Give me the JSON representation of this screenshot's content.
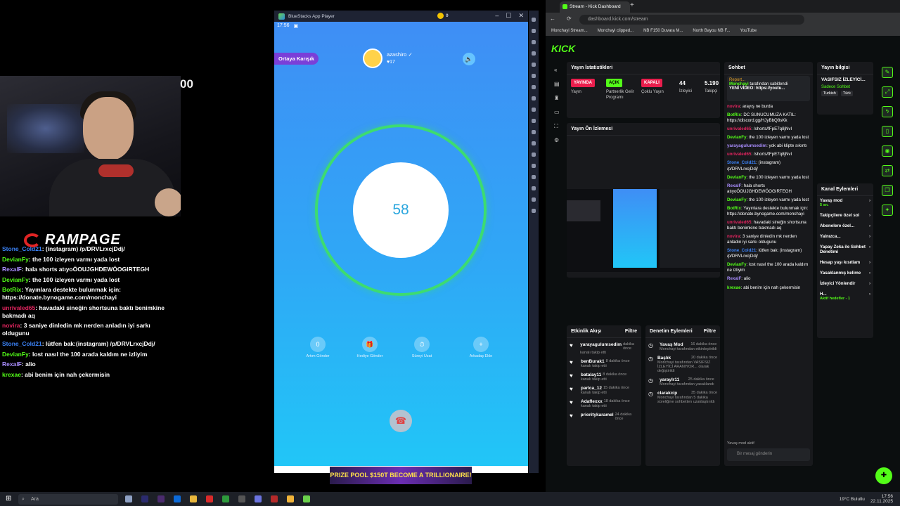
{
  "overlay": {
    "partial_number": "00",
    "brand": "RAMPAGE",
    "chat": [
      {
        "user": "Stone_Cold21",
        "color": "#3b82f6",
        "text": "(instagram) /p/DRVLrxcjDdj/"
      },
      {
        "user": "DevianFy",
        "color": "#53fc18",
        "text": "the 100 izleyen varmı yada lost"
      },
      {
        "user": "RexalF",
        "color": "#a78bfa",
        "text": "hala shorts atıyoÖOUJGHDEWÖOGIRTEGH"
      },
      {
        "user": "DevianFy",
        "color": "#53fc18",
        "text": "the 100 izleyen varmı yada lost"
      },
      {
        "user": "BotRix",
        "color": "#53fc18",
        "text": "Yayınlara destekte bulunmak için: https://donate.bynogame.com/monchayi"
      },
      {
        "user": "unrivaled65",
        "color": "#e0245e",
        "text": "havadaki sineğin shortsuna baktı benimkine bakmadı aq"
      },
      {
        "user": "novira",
        "color": "#e0245e",
        "text": "3 saniye dinledin mk nerden anladın iyi sarkı oldugunu"
      },
      {
        "user": "Stone_Cold21",
        "color": "#3b82f6",
        "text": "lütfen bak:(instagram) /p/DRVLrxcjDdj/"
      },
      {
        "user": "DevianFy",
        "color": "#53fc18",
        "text": "lost nasıl the 100 arada kaldım ne izliyim"
      },
      {
        "user": "RexalF",
        "color": "#a78bfa",
        "text": "alio"
      },
      {
        "user": "krexae",
        "color": "#53fc18",
        "text": "abi benim için nah çekermisin"
      }
    ]
  },
  "bluestacks": {
    "title": "BlueStacks App Player",
    "coins": "0",
    "time": "17:56",
    "mode_button": "Ortaya Karışık",
    "username": "azashiro",
    "likes": "17",
    "countdown": "58",
    "actions": [
      {
        "icon": "0",
        "label": "Artım Gönder"
      },
      {
        "icon": "🎁",
        "label": "Hediye Gönder"
      },
      {
        "icon": "⏱",
        "label": "Süreyi Uzat"
      },
      {
        "icon": "+",
        "label": "Arkadaş Ekle"
      }
    ],
    "ad_text": "PRIZE POOL $150T BECOME A TRILLIONAIRE!"
  },
  "browser": {
    "tab_title": "Stream - Kick Dashboard",
    "url": "dashboard.kick.com/stream",
    "bookmarks": [
      "Monchayi Stream...",
      "Monchayi clipped...",
      "NB F150 Duvara M...",
      "North Bayou NB F...",
      "YouTube"
    ],
    "logo": "KICK",
    "stats": {
      "title": "Yayın İstatistikleri",
      "badges": [
        {
          "label": "YAYINDA",
          "desc": "Yayın",
          "color": "#e91e4d"
        },
        {
          "label": "AÇIK",
          "desc": "Partnerlik Gelir Programı",
          "color": "#53fc18"
        },
        {
          "label": "KAPALI",
          "desc": "Çoklu Yayın",
          "color": "#e91e4d"
        }
      ],
      "viewers": "44",
      "viewers_label": "İzleyici",
      "followers": "5.190",
      "followers_label": "Takipçi"
    },
    "preview_title": "Yayın Ön İzlemesi",
    "activity": {
      "title": "Etkinlik Akışı",
      "filter": "Filtre",
      "items": [
        {
          "user": "yarayagulumsedim",
          "time": "dakika önce",
          "text": "kanalı takip etti"
        },
        {
          "user": "benBurak1",
          "time": "8 dakika önce",
          "text": "kanalı takip etti"
        },
        {
          "user": "batalay11",
          "time": "8 dakika önce",
          "text": "kanalı takip etti"
        },
        {
          "user": "parlca_12",
          "time": "15 dakika önce",
          "text": "kanalı takip etti"
        },
        {
          "user": "Adaflexxx",
          "time": "18 dakika önce",
          "text": "kanalı takip etti"
        },
        {
          "user": "prioritykaramel",
          "time": "24 dakika önce",
          "text": ""
        }
      ]
    },
    "moderation": {
      "title": "Denetim Eylemleri",
      "filter": "Filtre",
      "items": [
        {
          "title": "Yavaş Mod",
          "time": "16 dakika önce",
          "text": "Monchayi tarafından etkinleştirildi"
        },
        {
          "title": "Başlık",
          "time": "20 dakika önce",
          "text": "Monchayi tarafından VASIFSIZ İZLEYİCİ ARANIYOR... olarak değiştirildi"
        },
        {
          "title": "yaraylr11",
          "time": "25 dakika önce",
          "text": "Monchayi tarafından yasaklandı"
        },
        {
          "title": "clarakcip",
          "time": "35 dakika önce",
          "text": "Monchayi tarafından 5 dakika süreliğine sohbetten uzaklaştırıldı"
        }
      ]
    },
    "chat": {
      "title": "Sohbet",
      "report": "Report...",
      "pinned_user": "Monchayi",
      "pinned_by": "tarafından sabitlendi",
      "pinned_text": "YENİ VİDEO: https://youtu...",
      "messages": [
        {
          "user": "novira",
          "color": "#e0245e",
          "text": "arayış ne burda"
        },
        {
          "user": "BotRix",
          "color": "#53fc18",
          "text": "DC SUNUCUMUZA KATIL: https://discord.gg/HJyBbQ8sKk"
        },
        {
          "user": "unrivaled65",
          "color": "#e0245e",
          "text": "/shorts/fFpE7q8jNvI"
        },
        {
          "user": "DevianFy",
          "color": "#53fc18",
          "text": "the 100 izleyen varmı yada lost"
        },
        {
          "user": "yarayagulumsedim",
          "color": "#a78bfa",
          "text": "yok abi klipte sıkıntı"
        },
        {
          "user": "unrivaled65",
          "color": "#e0245e",
          "text": "/shorts/fFpE7q8jNvI"
        },
        {
          "user": "Stone_Cold21",
          "color": "#3b82f6",
          "text": "(instagram) /p/DRVLrxcjDdj/"
        },
        {
          "user": "DevianFy",
          "color": "#53fc18",
          "text": "the 100 izleyen varmı yada lost"
        },
        {
          "user": "RexalF",
          "color": "#a78bfa",
          "text": "hala shorts atıyoÖOUJGHDEWÖOGIRTEGH"
        },
        {
          "user": "DevianFy",
          "color": "#53fc18",
          "text": "the 100 izleyen varmı yada lost"
        },
        {
          "user": "BotRix",
          "color": "#53fc18",
          "text": "Yayınlara destekte bulunmak için: https://donate.bynogame.com/monchayi"
        },
        {
          "user": "unrivaled65",
          "color": "#e0245e",
          "text": "havadaki sineğin shortsuna baktı benimkine bakmadı aq"
        },
        {
          "user": "novira",
          "color": "#e0245e",
          "text": "3 saniye dinledin mk nerden anladın iyi sarkı oldugunu"
        },
        {
          "user": "Stone_Cold21",
          "color": "#3b82f6",
          "text": "lütfen bak: (instagram) /p/DRVLrxcjDdj/"
        },
        {
          "user": "DevianFy",
          "color": "#53fc18",
          "text": "lost nasıl the 100 arada kaldım ne izliyim"
        },
        {
          "user": "RexalF",
          "color": "#a78bfa",
          "text": "alio"
        },
        {
          "user": "krexae",
          "color": "#53fc18",
          "text": "abi benim için nah çekermisin"
        }
      ],
      "slow_mode": "Yavaş mod aktif",
      "input_placeholder": "Bir mesaj gönderin"
    },
    "stream_info": {
      "title": "Yayın bilgisi",
      "stream_title": "VASIFSIZ İZLEYİCİ...",
      "tag1": "Sadece Sohbet",
      "tag2": "Turkish",
      "tag3": "Türk"
    },
    "channel_actions": {
      "title": "Kanal Eylemleri",
      "items": [
        {
          "label": "Yavaş mod",
          "sub": "5 sn."
        },
        {
          "label": "Takipçilere özel sol",
          "sub": ""
        },
        {
          "label": "Abonelere özel...",
          "sub": ""
        },
        {
          "label": "Yalnızca...",
          "sub": ""
        },
        {
          "label": "Yapay Zeka ile Sohbet Denetimi",
          "sub": ""
        },
        {
          "label": "Hesap yaşı kısıtlam",
          "sub": ""
        },
        {
          "label": "Yasaklanmış kelime",
          "sub": ""
        },
        {
          "label": "İzleyici Yönlendir",
          "sub": ""
        },
        {
          "label": "H...",
          "sub": "Aktif hedefler - 1"
        }
      ]
    }
  },
  "taskbar": {
    "search": "Ara",
    "weather": "19°C Bulutlu",
    "time": "17:56",
    "date": "22.11.2025"
  }
}
